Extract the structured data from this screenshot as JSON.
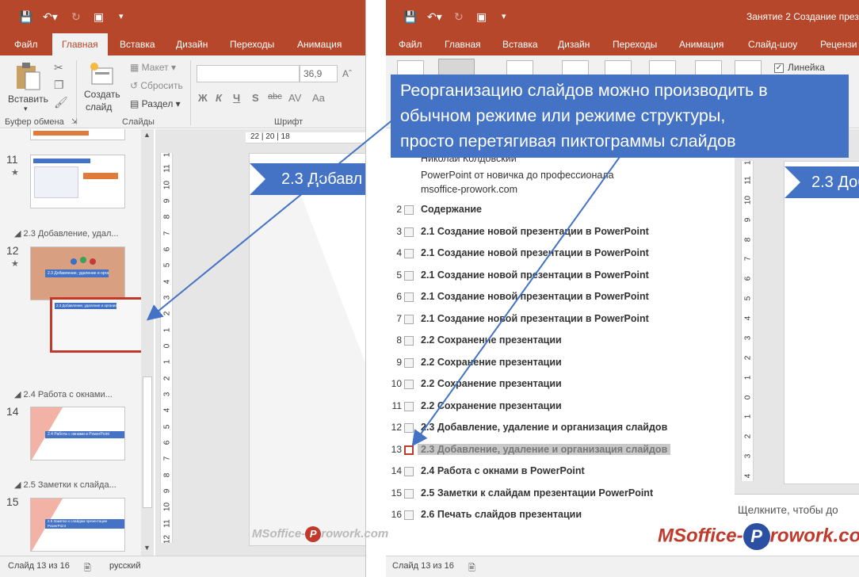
{
  "left_window": {
    "tabs": [
      "Файл",
      "Главная",
      "Вставка",
      "Дизайн",
      "Переходы",
      "Анимация"
    ],
    "active_tab": "Главная",
    "ribbon": {
      "paste_label": "Вставить",
      "create_slide_line1": "Создать",
      "create_slide_line2": "слайд",
      "layout": "Макет",
      "reset": "Сбросить",
      "section": "Раздел",
      "font_size": "36,9",
      "group_clipboard": "Буфер обмена",
      "group_slides": "Слайды",
      "group_font": "Шрифт",
      "format_buttons": [
        "Ж",
        "К",
        "Ч",
        "S",
        "abc",
        "AV",
        "Aa"
      ]
    },
    "thumbnails": {
      "items": [
        {
          "num": "11",
          "star": "★"
        },
        {
          "section": "2.3 Добавление, удал..."
        },
        {
          "num": "12",
          "star": "★",
          "thumb_text": "2.3 Добавление, удаление и организация слайдов"
        },
        {
          "drag_text": "2.3 Добавление, удаление и организация слайдов"
        },
        {
          "section": "2.4 Работа с окнами..."
        },
        {
          "num": "14",
          "thumb_text": "2.4 Работа с окнами в PowerPoint"
        },
        {
          "section": "2.5 Заметки к слайда..."
        },
        {
          "num": "15",
          "thumb_text": "2.5 Заметки к слайдам презентации PowerPoint"
        }
      ]
    },
    "ruler_top": "22 | 20 | 18",
    "ruler_left_nums": [
      "12",
      "11",
      "10",
      "9",
      "8",
      "7",
      "6",
      "5",
      "4",
      "3",
      "2",
      "1",
      "0",
      "1",
      "2",
      "3",
      "4",
      "5",
      "6",
      "7",
      "8",
      "9",
      "10",
      "11",
      "12"
    ],
    "slide_title": "2.3 Добавл",
    "status": {
      "slide": "Слайд 13 из 16",
      "lang": "русский"
    }
  },
  "right_window": {
    "title": "Занятие 2 Создание презе",
    "tabs": [
      "Файл",
      "Главная",
      "Вставка",
      "Дизайн",
      "Переходы",
      "Анимация",
      "Слайд-шоу",
      "Рецензи"
    ],
    "ribbon": {
      "ruler_checkbox": "Линейка"
    },
    "outline": {
      "sub_lines": [
        "Николай Колдовский",
        "PowerPoint от новичка до профессионала",
        "msoffice-prowork.com"
      ],
      "rows": [
        {
          "num": "2",
          "text": "Содержание"
        },
        {
          "num": "3",
          "text": "2.1 Создание новой презентации в PowerPoint"
        },
        {
          "num": "4",
          "text": "2.1 Создание новой презентации в PowerPoint"
        },
        {
          "num": "5",
          "text": "2.1 Создание новой презентации в PowerPoint"
        },
        {
          "num": "6",
          "text": "2.1 Создание новой презентации в PowerPoint"
        },
        {
          "num": "7",
          "text": "2.1 Создание новой презентации в PowerPoint"
        },
        {
          "num": "8",
          "text": "2.2 Сохранение презентации"
        },
        {
          "num": "9",
          "text": "2.2 Сохранение презентации"
        },
        {
          "num": "10",
          "text": "2.2 Сохранение презентации"
        },
        {
          "num": "11",
          "text": "2.2 Сохранение презентации"
        },
        {
          "num": "12",
          "text": "2.3 Добавление, удаление и организация слайдов"
        },
        {
          "num": "13",
          "text": "2.3 Добавление, удаление и организация слайдов"
        },
        {
          "num": "14",
          "text": "2.4 Работа с окнами в PowerPoint"
        },
        {
          "num": "15",
          "text": "2.5 Заметки к слайдам презентации PowerPoint"
        },
        {
          "num": "16",
          "text": "2.6 Печать слайдов презентации"
        }
      ]
    },
    "slide_title": "2.3 Доба",
    "notes_placeholder": "Щелкните, чтобы до",
    "status": {
      "slide": "Слайд 13 из 16"
    }
  },
  "callout": {
    "line1": "Реорганизацию слайдов можно производить в",
    "line2": "обычном режиме или режиме структуры,",
    "line3": "просто перетягивая пиктограммы слайдов"
  },
  "watermark": {
    "prefix": "MSoffice-",
    "p": "P",
    "suffix": "rowork.com"
  },
  "colors": {
    "accent": "#b7472a",
    "callout": "#4472c4",
    "drag": "#c0392b"
  }
}
